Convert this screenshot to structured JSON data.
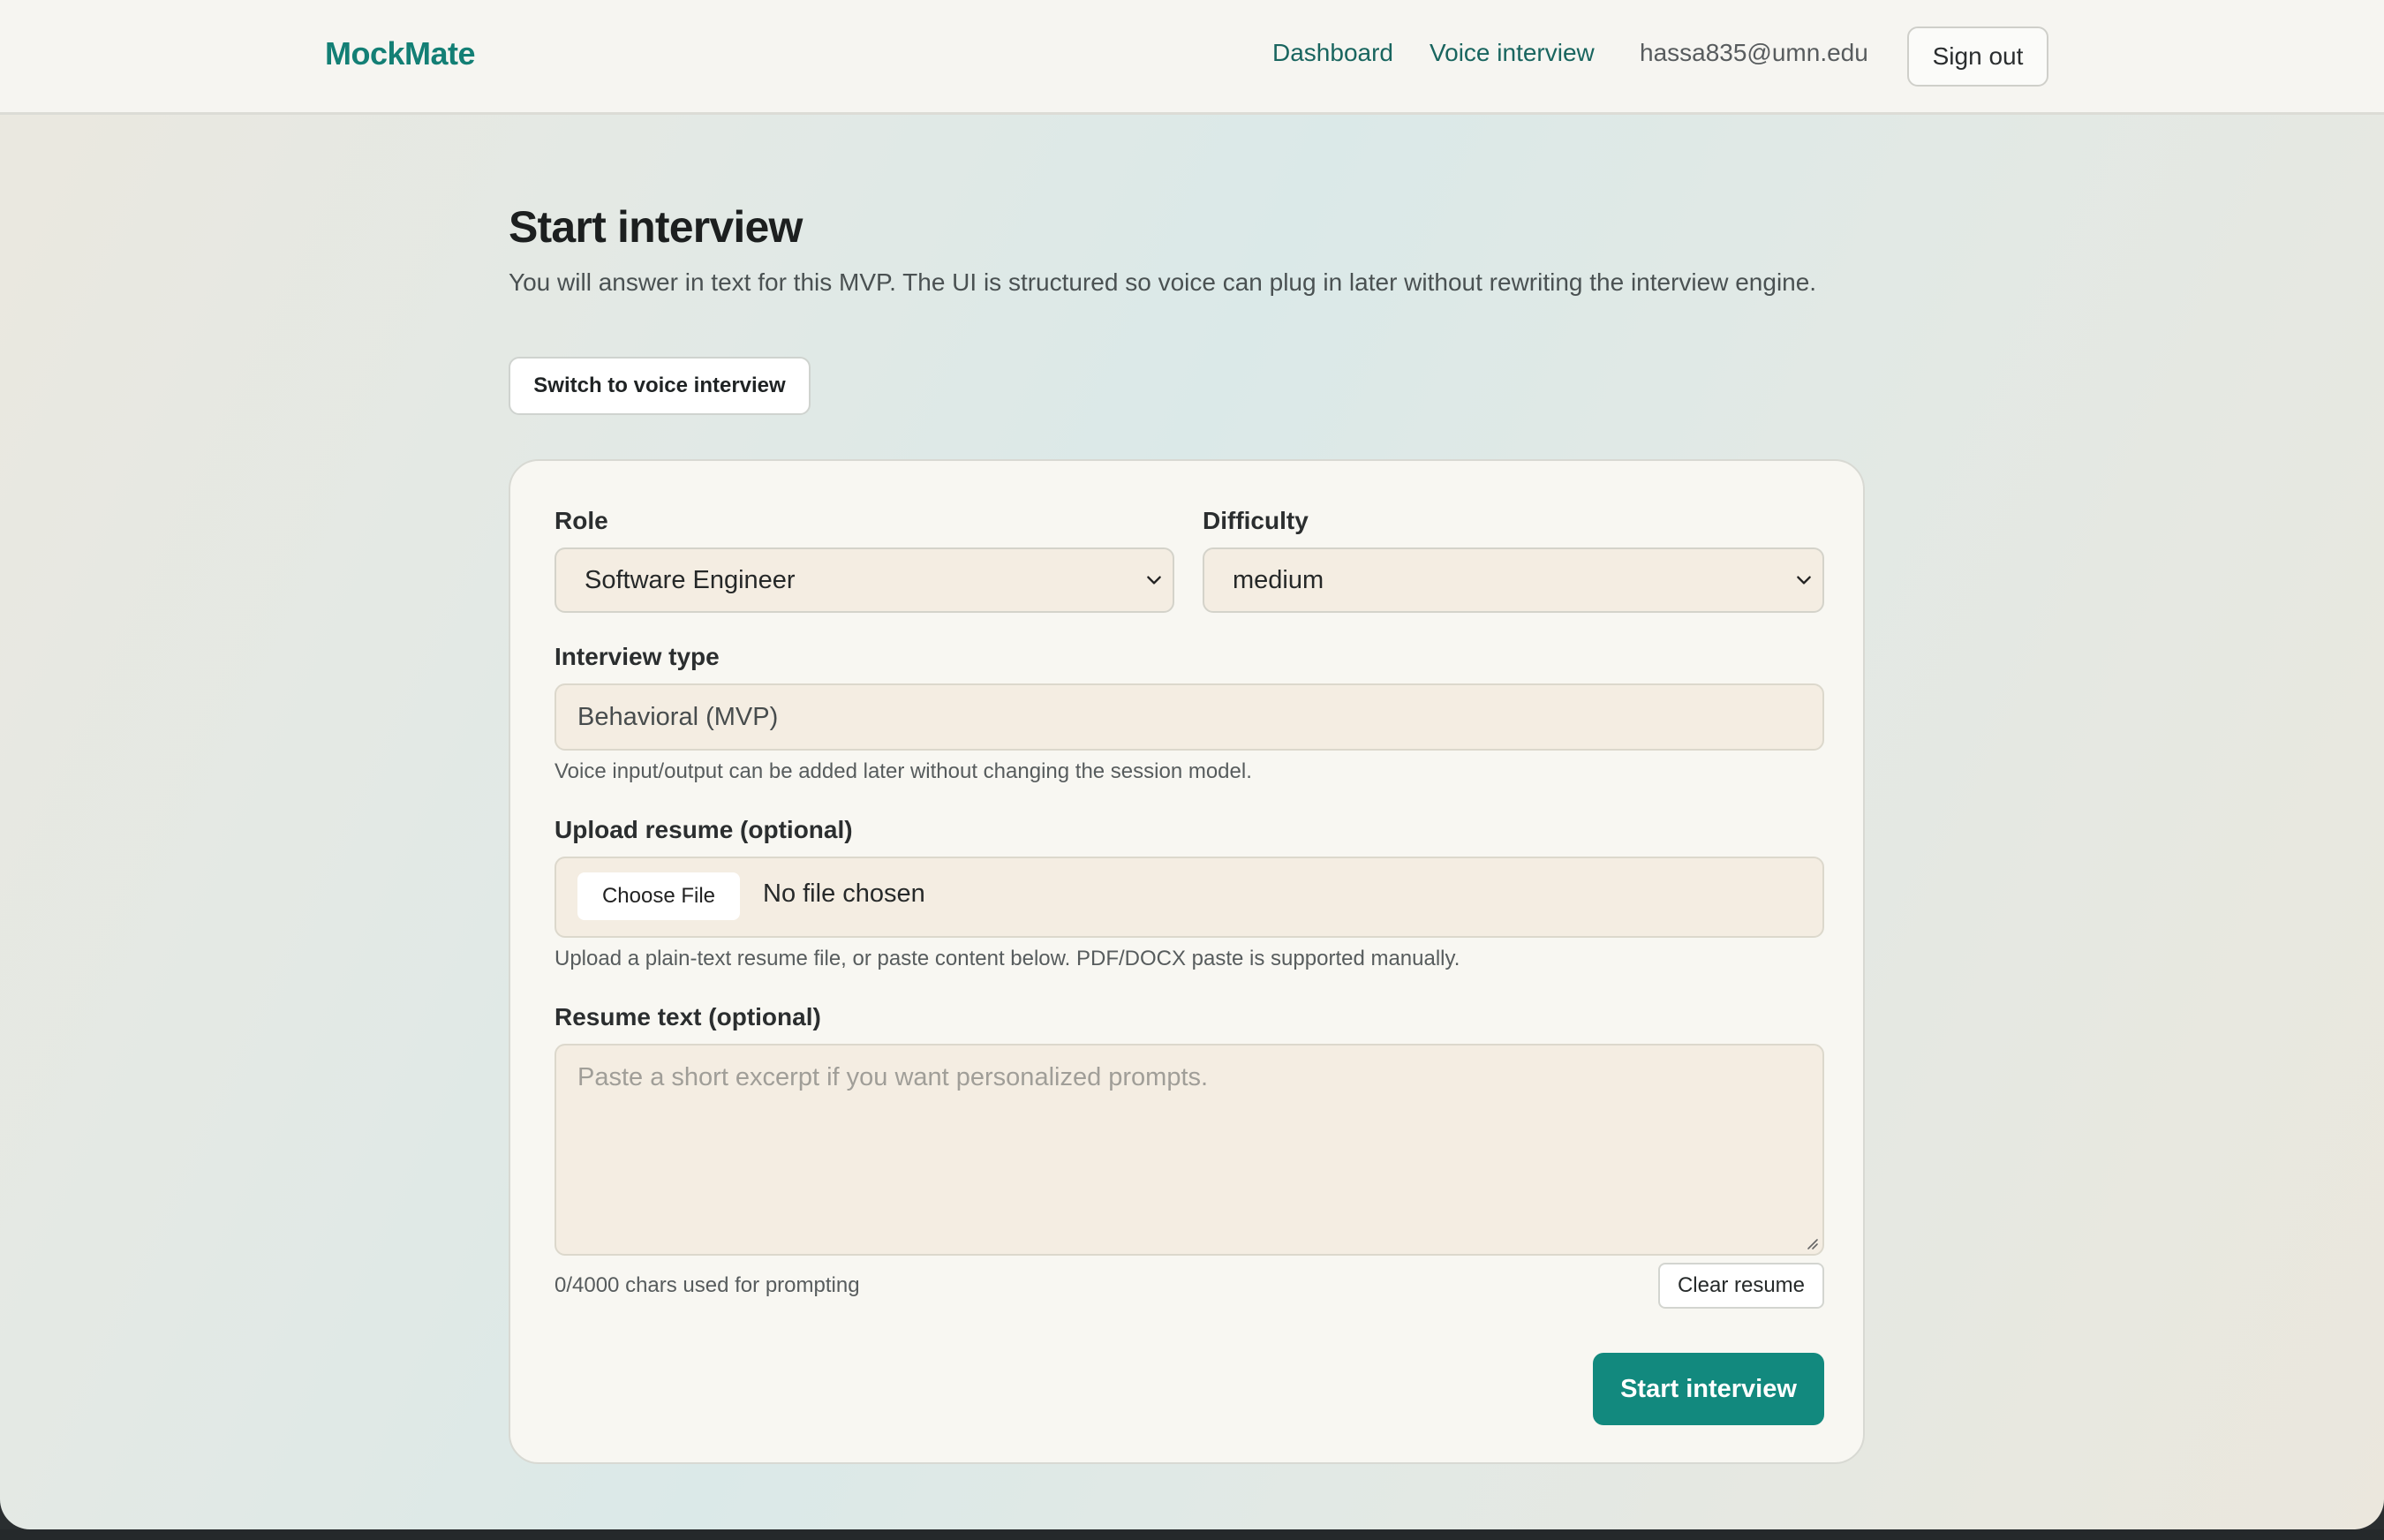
{
  "header": {
    "brand": "MockMate",
    "nav": {
      "dashboard": "Dashboard",
      "voice_interview": "Voice interview"
    },
    "user_email": "hassa835@umn.edu",
    "sign_out": "Sign out"
  },
  "page": {
    "title": "Start interview",
    "description": "You will answer in text for this MVP. The UI is structured so voice can plug in later without rewriting the interview engine.",
    "switch_button": "Switch to voice interview"
  },
  "form": {
    "role": {
      "label": "Role",
      "value": "Software Engineer"
    },
    "difficulty": {
      "label": "Difficulty",
      "value": "medium"
    },
    "interview_type": {
      "label": "Interview type",
      "value": "Behavioral (MVP)",
      "hint": "Voice input/output can be added later without changing the session model."
    },
    "resume_upload": {
      "label": "Upload resume (optional)",
      "button": "Choose File",
      "status": "No file chosen",
      "hint": "Upload a plain-text resume file, or paste content below. PDF/DOCX paste is supported manually."
    },
    "resume_text": {
      "label": "Resume text (optional)",
      "placeholder": "Paste a short excerpt if you want personalized prompts.",
      "counter": "0/4000 chars used for prompting",
      "clear_button": "Clear resume"
    },
    "submit": "Start interview"
  },
  "colors": {
    "brand": "#137f75",
    "primary_button": "#12897e",
    "field_background": "#f4ede2"
  },
  "icons": {
    "select_arrow": "chevron-down-icon"
  }
}
